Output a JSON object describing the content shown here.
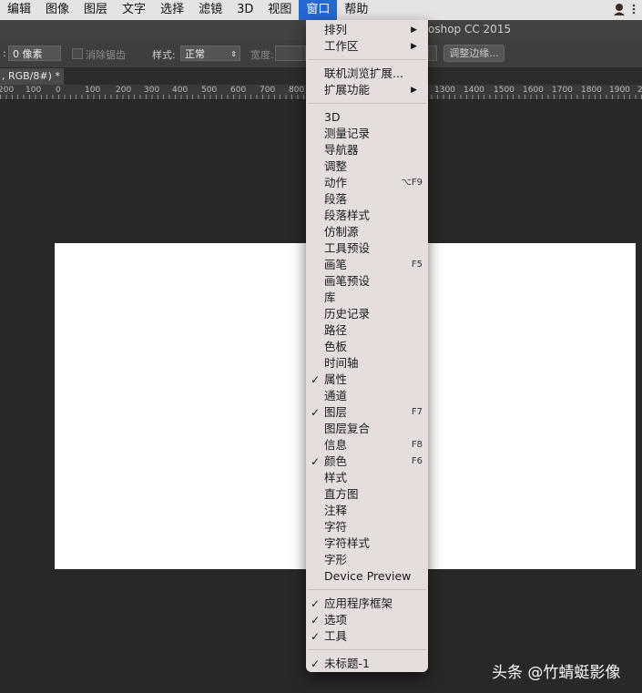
{
  "menubar": {
    "items": [
      "编辑",
      "图像",
      "图层",
      "文字",
      "选择",
      "滤镜",
      "3D",
      "视图",
      "窗口",
      "帮助"
    ],
    "active_label": "窗口"
  },
  "titlebar": {
    "title": "oshop CC 2015"
  },
  "options_bar": {
    "feather_label": ":",
    "feather_value": "0 像素",
    "antialias_label": "消除锯齿",
    "style_label": "样式:",
    "style_value": "正常",
    "width_label": "宽度:",
    "refine_edge_button": "调整边缘..."
  },
  "document_tab": {
    "label": ", RGB/8#) *"
  },
  "ruler": {
    "labels_left": [
      "200",
      "100",
      "0",
      "100",
      "200",
      "300",
      "400",
      "500",
      "600",
      "700",
      "800"
    ],
    "labels_right": [
      "1300",
      "1400",
      "1500",
      "1600",
      "1700",
      "1800",
      "1900",
      "2"
    ]
  },
  "window_menu": {
    "sections": [
      {
        "items": [
          {
            "label": "排列",
            "submenu": true
          },
          {
            "label": "工作区",
            "submenu": true
          }
        ]
      },
      {
        "items": [
          {
            "label": "联机浏览扩展..."
          },
          {
            "label": "扩展功能",
            "submenu": true
          }
        ]
      },
      {
        "items": [
          {
            "label": "3D"
          },
          {
            "label": "测量记录"
          },
          {
            "label": "导航器"
          },
          {
            "label": "调整"
          },
          {
            "label": "动作",
            "shortcut": "⌥F9"
          },
          {
            "label": "段落"
          },
          {
            "label": "段落样式"
          },
          {
            "label": "仿制源"
          },
          {
            "label": "工具预设"
          },
          {
            "label": "画笔",
            "shortcut": "F5"
          },
          {
            "label": "画笔预设"
          },
          {
            "label": "库"
          },
          {
            "label": "历史记录"
          },
          {
            "label": "路径"
          },
          {
            "label": "色板"
          },
          {
            "label": "时间轴"
          },
          {
            "label": "属性",
            "checked": true
          },
          {
            "label": "通道"
          },
          {
            "label": "图层",
            "checked": true,
            "shortcut": "F7"
          },
          {
            "label": "图层复合"
          },
          {
            "label": "信息",
            "shortcut": "F8"
          },
          {
            "label": "颜色",
            "checked": true,
            "shortcut": "F6"
          },
          {
            "label": "样式"
          },
          {
            "label": "直方图"
          },
          {
            "label": "注释"
          },
          {
            "label": "字符"
          },
          {
            "label": "字符样式"
          },
          {
            "label": "字形"
          },
          {
            "label": "Device Preview"
          }
        ]
      },
      {
        "items": [
          {
            "label": "应用程序框架",
            "checked": true
          },
          {
            "label": "选项",
            "checked": true
          },
          {
            "label": "工具",
            "checked": true
          }
        ]
      },
      {
        "items": [
          {
            "label": "未标题-1",
            "checked": true
          }
        ]
      }
    ]
  },
  "watermark": {
    "text": "头条 @竹蜻蜓影像"
  }
}
